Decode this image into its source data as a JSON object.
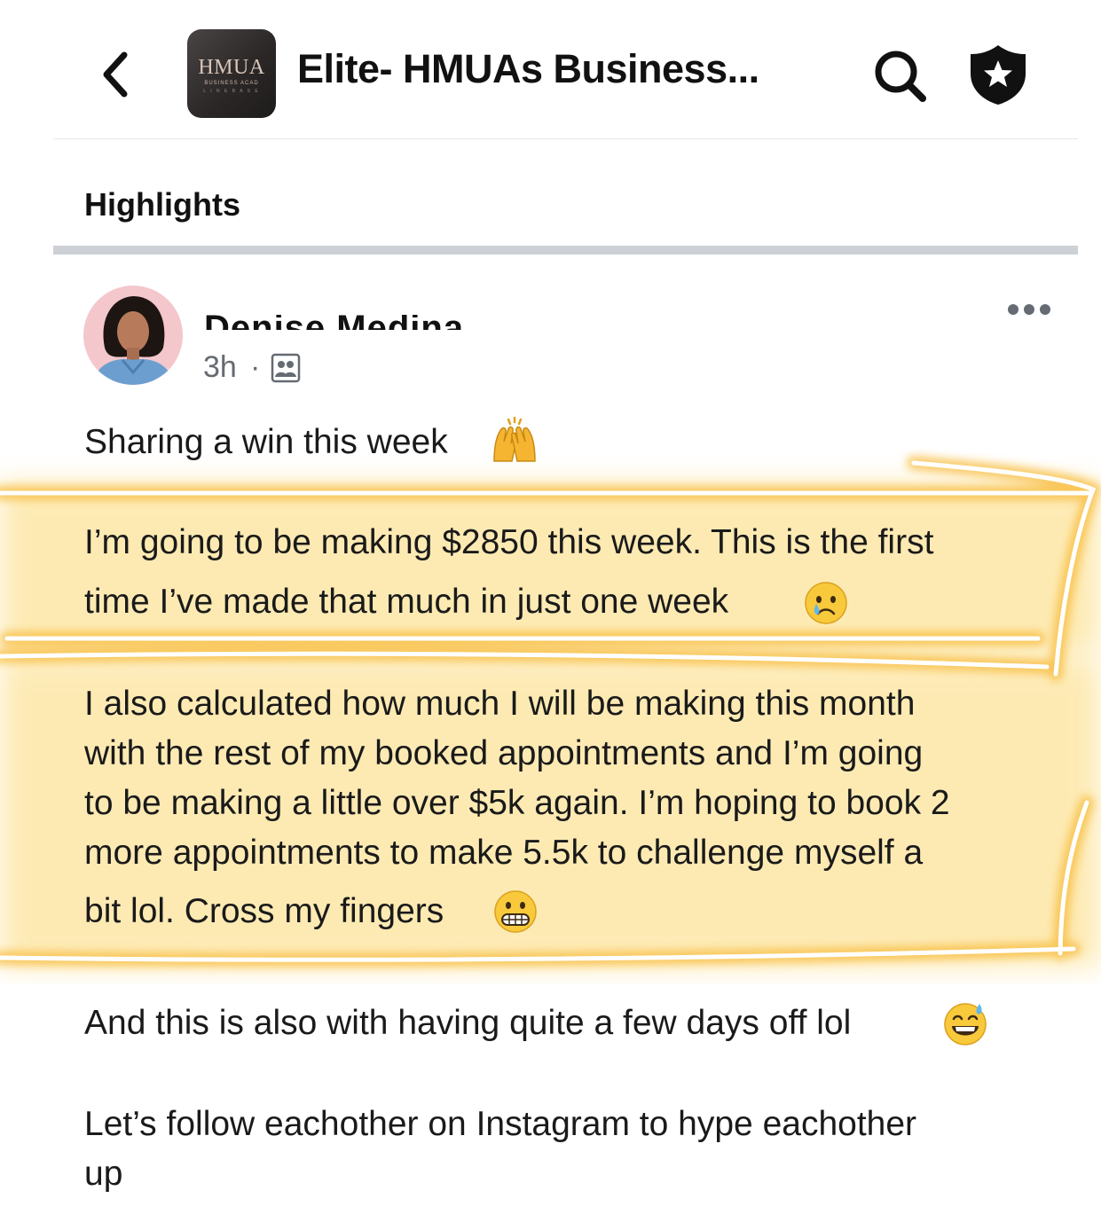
{
  "header": {
    "back_icon": "chevron-left-icon",
    "group_logo": {
      "line1": "HMUA",
      "line2": "BUSINESS ACAD",
      "line3": "L I N E  B A S E"
    },
    "group_name": "Elite- HMUAs Business...",
    "search_icon": "search-icon",
    "admin_icon": "shield-star-icon"
  },
  "section": {
    "label": "Highlights"
  },
  "post": {
    "author": "Denise Medina",
    "time": "3h",
    "separator": "·",
    "audience_icon": "group-members-icon",
    "more_icon": "ellipsis-icon",
    "lines": [
      "Sharing a win this week",
      "I’m going to be making $2850 this week. This is the first",
      "time I’ve made that much in just one week",
      "I also calculated how much I will be making this month",
      "with the rest of my booked appointments and I’m going",
      "to be making a little over $5k again. I’m hoping to book 2",
      "more appointments to make 5.5k to challenge myself a",
      "bit lol. Cross my fingers",
      "And this is also with having quite a few days off lol",
      "Let’s follow eachother on Instagram to hype eachother",
      "up"
    ],
    "emojis": [
      "raising-hands-emoji",
      "crying-face-emoji",
      "grimacing-face-emoji",
      "grinning-sweat-emoji"
    ]
  },
  "colors": {
    "highlight_glow": "#f9c43a",
    "tab_bar": "#cdd0d5",
    "meta_text": "#656b72"
  }
}
